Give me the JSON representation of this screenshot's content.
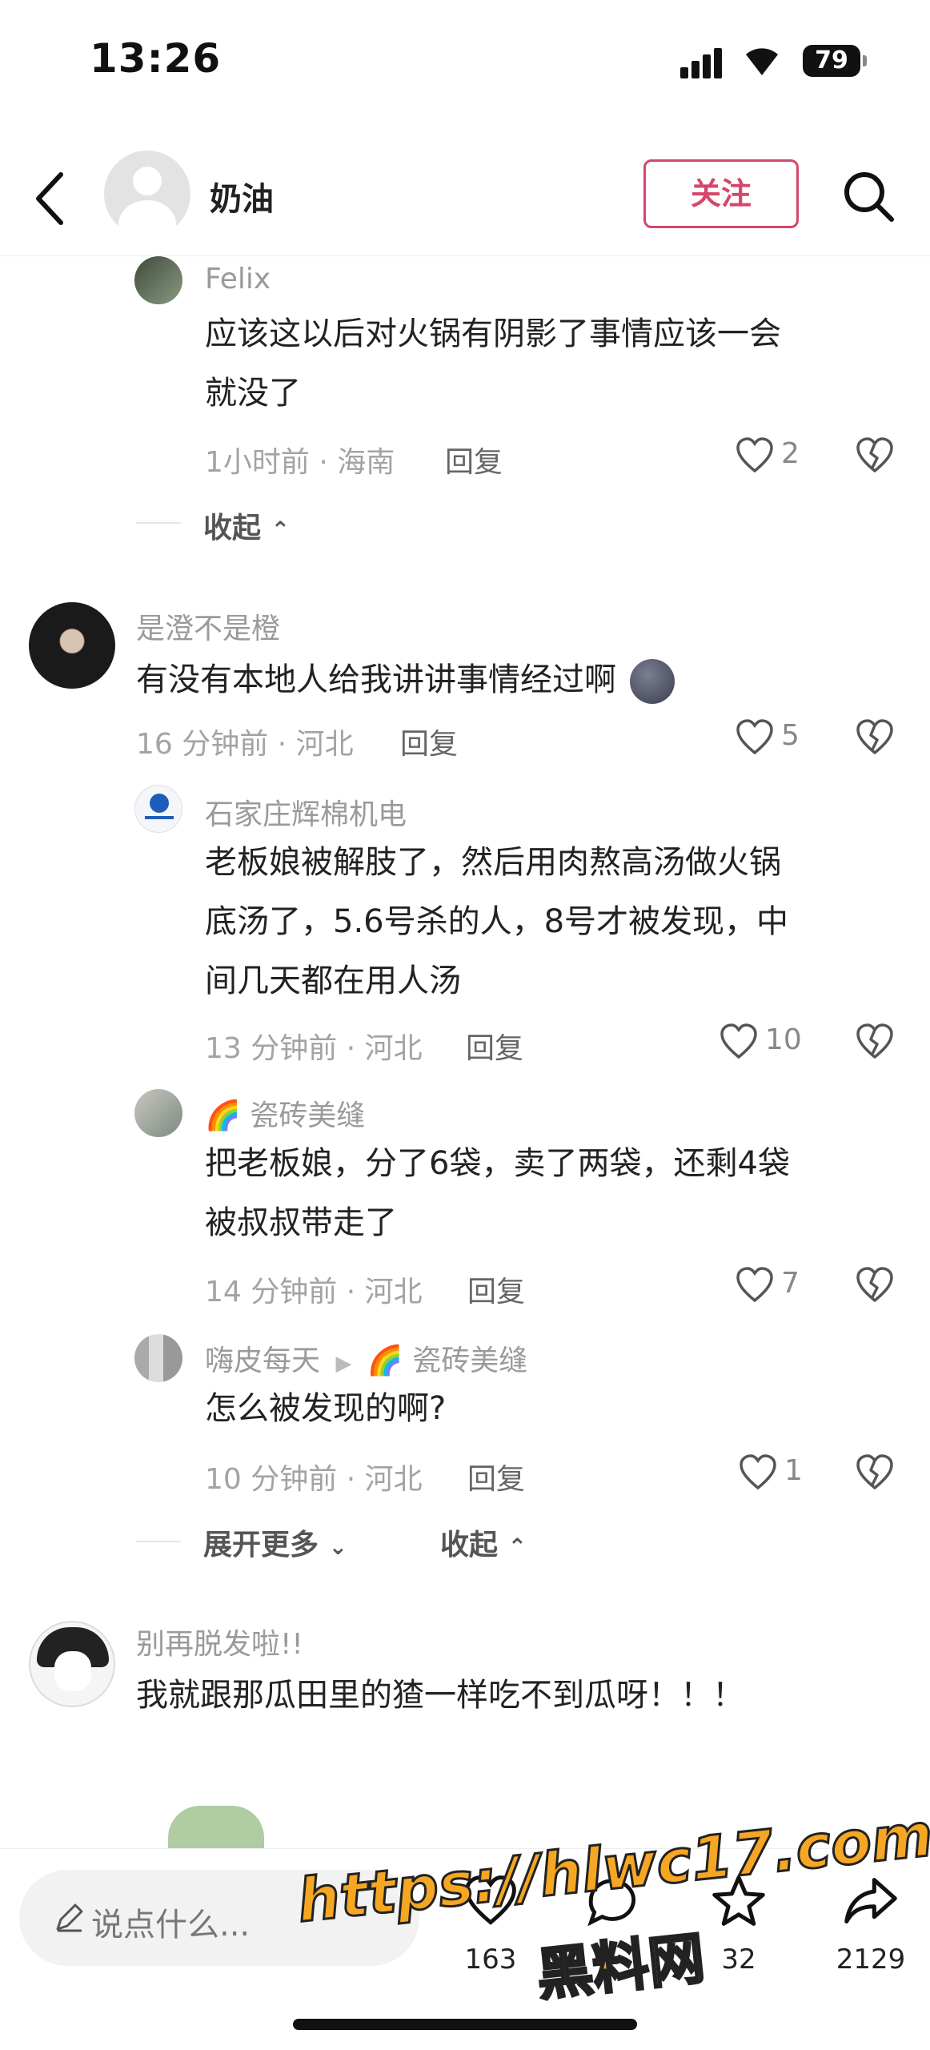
{
  "status_bar": {
    "time": "13:26",
    "battery": "79"
  },
  "header": {
    "name": "奶油",
    "follow_label": "关注"
  },
  "comments": [
    {
      "username": "Felix",
      "content_lines": [
        "应该这以后对火锅有阴影了事情应该一会",
        "就没了"
      ],
      "meta": "1小时前 · 海南",
      "reply_label": "回复",
      "likes": "2"
    },
    {
      "collapse_label": "收起"
    },
    {
      "username": "是澄不是橙",
      "content": "有没有本地人给我讲讲事情经过啊",
      "meta": "16 分钟前 · 河北",
      "reply_label": "回复",
      "likes": "5"
    },
    {
      "username": "石家庄辉棉机电",
      "content_lines": [
        "老板娘被解肢了，然后用肉熬高汤做火锅",
        "底汤了，5.6号杀的人，8号才被发现，中",
        "间几天都在用人汤"
      ],
      "meta": "13 分钟前 · 河北",
      "reply_label": "回复",
      "likes": "10"
    },
    {
      "username": "瓷砖美缝",
      "content_lines": [
        "把老板娘，分了6袋，卖了两袋，还剩4袋",
        "被叔叔带走了"
      ],
      "meta": "14 分钟前 · 河北",
      "reply_label": "回复",
      "likes": "7"
    },
    {
      "username": "嗨皮每天",
      "reply_to": "瓷砖美缝",
      "content": "怎么被发现的啊?",
      "meta": "10 分钟前 · 河北",
      "reply_label": "回复",
      "likes": "1"
    },
    {
      "expand_label": "展开更多",
      "collapse_label": "收起"
    },
    {
      "username": "别再脱发啦!!",
      "content": "我就跟那瓜田里的猹一样吃不到瓜呀！！！"
    }
  ],
  "bottom_bar": {
    "input_placeholder": "说点什么...",
    "like_count": "163",
    "star_count": "32",
    "share_count": "2129"
  },
  "watermark": {
    "url": "https://hlwc17.com",
    "site": "黑料网"
  },
  "colors": {
    "accent": "#d5466b",
    "watermark": "#f5a623"
  }
}
